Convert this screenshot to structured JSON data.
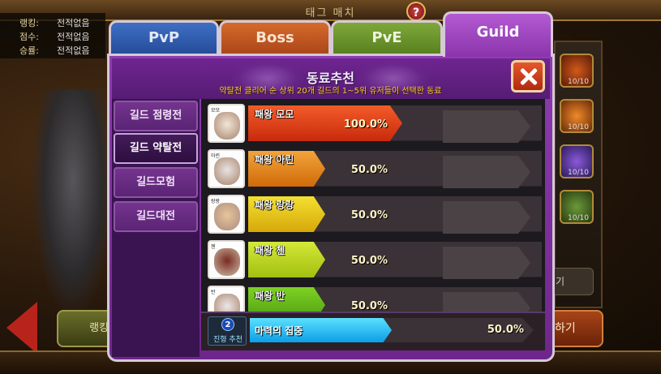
{
  "background": {
    "title": "태그 매치",
    "help_icon": "?",
    "stats": [
      {
        "label": "랭킹:",
        "value": "전적없음"
      },
      {
        "label": "점수:",
        "value": "전적없음"
      },
      {
        "label": "승률:",
        "value": "전적없음"
      }
    ],
    "slots": [
      {
        "count": "10/10"
      },
      {
        "count": "10/10"
      },
      {
        "count": "10/10"
      },
      {
        "count": "10/10"
      }
    ],
    "left_button_label": "랭킹",
    "right_mid_label": "기",
    "right_button_label": "하기"
  },
  "tabs": [
    {
      "label": "PvP"
    },
    {
      "label": "Boss"
    },
    {
      "label": "PvE"
    },
    {
      "label": "Guild"
    }
  ],
  "dialog": {
    "title": "동료추천",
    "subtitle": "약탈전 클리어 순 상위 20개 길드의 1~5위 유저들이 선택한 동료"
  },
  "side_menu": [
    {
      "label": "길드 점령전",
      "active": false
    },
    {
      "label": "길드 약탈전",
      "active": true
    },
    {
      "label": "길드모험",
      "active": false
    },
    {
      "label": "길드대전",
      "active": false
    }
  ],
  "companions": [
    {
      "name": "패왕 모모",
      "tag": "모모",
      "percent": "100.0%",
      "value": 100,
      "color": "red",
      "face_color": "#f2e6d6"
    },
    {
      "name": "패왕 아린",
      "tag": "아린",
      "percent": "50.0%",
      "value": 50,
      "color": "orange",
      "face_color": "#e8e2e4"
    },
    {
      "name": "패왕 랑랑",
      "tag": "랑랑",
      "percent": "50.0%",
      "value": 50,
      "color": "yellow",
      "face_color": "#e8c49a"
    },
    {
      "name": "패왕 첸",
      "tag": "첸",
      "percent": "50.0%",
      "value": 50,
      "color": "lime",
      "face_color": "#7a2a22"
    },
    {
      "name": "패왕 반",
      "tag": "반",
      "percent": "50.0%",
      "value": 50,
      "color": "green",
      "face_color": "#ece6ea"
    }
  ],
  "formation": {
    "number": "2",
    "label": "진형 추천"
  },
  "skill": {
    "name": "마력의 집중",
    "percent": "50.0%",
    "value": 50
  }
}
